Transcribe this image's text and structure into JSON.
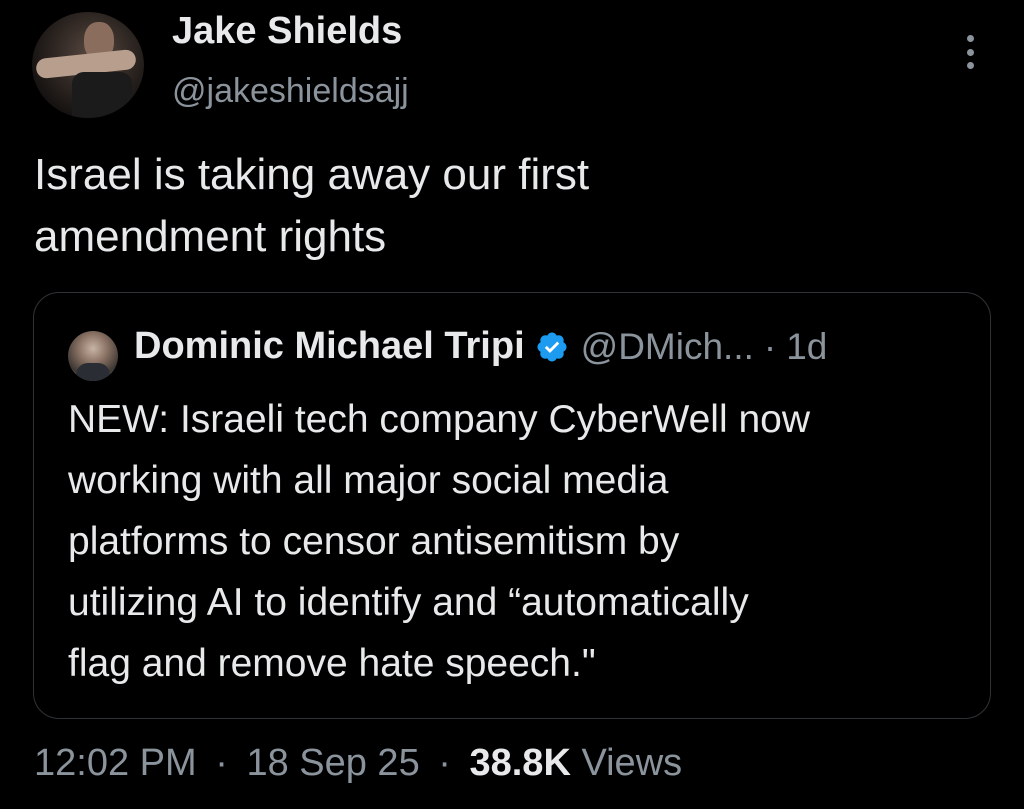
{
  "author": {
    "name": "Jake Shields",
    "handle": "@jakeshieldsajj"
  },
  "tweet": {
    "text_line1": "Israel is taking away our first",
    "text_line2": "amendment rights"
  },
  "quote": {
    "name": "Dominic Michael Tripi",
    "handle": "@DMich...",
    "separator": "·",
    "time": "1d",
    "verified": true,
    "lines": [
      "NEW: Israeli tech company CyberWell now",
      "working with all major social media",
      "platforms to censor antisemitism by",
      "utilizing AI to identify and “automatically",
      "flag and remove hate speech.\""
    ]
  },
  "meta": {
    "time": "12:02 PM",
    "separator": "·",
    "date": "18 Sep 25",
    "views_count": "38.8K",
    "views_label": "Views"
  },
  "colors": {
    "background": "#000000",
    "text_primary": "#e7e9ea",
    "text_secondary": "#8b949c",
    "border": "#2f3336",
    "verified": "#1d9bf0"
  },
  "icons": {
    "more": "more-vertical-icon",
    "verified": "verified-badge-icon"
  }
}
